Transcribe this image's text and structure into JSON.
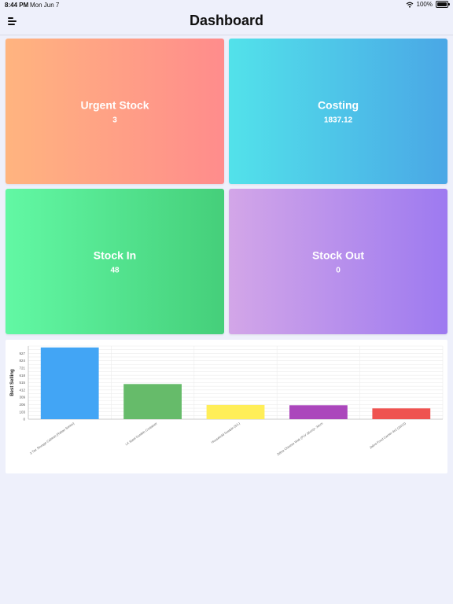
{
  "status_bar": {
    "time": "8:44 PM",
    "date": "Mon Jun 7",
    "battery": "100%"
  },
  "navbar": {
    "title": "Dashboard"
  },
  "cards": {
    "urgent_stock": {
      "label": "Urgent Stock",
      "value": "3"
    },
    "costing": {
      "label": "Costing",
      "value": "1837.12"
    },
    "stock_in": {
      "label": "Stock In",
      "value": "48"
    },
    "stock_out": {
      "label": "Stock Out",
      "value": "0"
    }
  },
  "icons": {
    "menu": "menu-icon",
    "wifi": "wifi-icon",
    "battery": "battery-icon"
  },
  "colors": {
    "background": "#eef0fb",
    "urgent_from": "#ffb47f",
    "urgent_to": "#ff8c8c",
    "costing_from": "#52e2ea",
    "costing_to": "#4aa7e6",
    "stockin_from": "#62f8a4",
    "stockin_to": "#45cf7a",
    "stockout_from": "#d3a6e8",
    "stockout_to": "#9d7af0"
  },
  "chart_data": {
    "type": "bar",
    "title": "",
    "xlabel": "",
    "ylabel": "Best Selling",
    "ylim": [
      0,
      1030
    ],
    "yticks": [
      "0",
      "103",
      "206",
      "309",
      "412",
      "515",
      "618",
      "721",
      "824",
      "927"
    ],
    "grid": true,
    "legend": "none",
    "categories": [
      "3 Tier Storage Cabinet (Rattan Series)",
      "LX Steel Dustbin Container",
      "Household Dustpin (S/L)",
      "Zebra Chinese Wok (PLV 36cm)+ 34cm",
      "Zebra Food Carrier 4x2 (20/15)"
    ],
    "values": [
      1010,
      495,
      200,
      196,
      152
    ],
    "colors": [
      "#42a5f5",
      "#66bb6a",
      "#ffee58",
      "#ab47bc",
      "#ef5350"
    ]
  }
}
